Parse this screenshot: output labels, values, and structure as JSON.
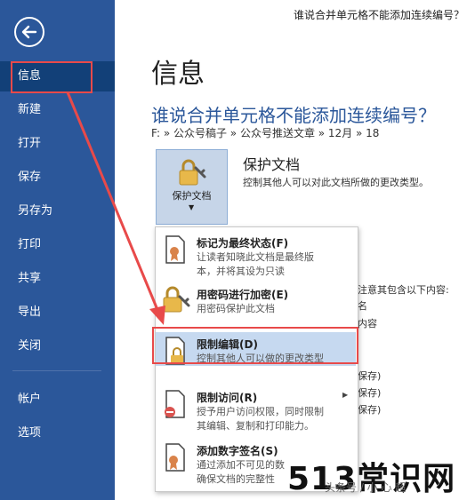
{
  "topbar": {
    "doc_name": "谁说合并单元格不能添加连续编号？"
  },
  "sidebar": {
    "items": [
      {
        "label": "信息"
      },
      {
        "label": "新建"
      },
      {
        "label": "打开"
      },
      {
        "label": "保存"
      },
      {
        "label": "另存为"
      },
      {
        "label": "打印"
      },
      {
        "label": "共享"
      },
      {
        "label": "导出"
      },
      {
        "label": "关闭"
      },
      {
        "label": "帐户"
      },
      {
        "label": "选项"
      }
    ]
  },
  "main": {
    "title": "信息",
    "doc_title": "谁说合并单元格不能添加连续编号？",
    "breadcrumb": "F: » 公众号稿子 » 公众号推送文章 » 12月 » 18",
    "protect": {
      "button_label": "保护文档",
      "heading": "保护文档",
      "description": "控制其他人可以对此文档所做的更改类型。"
    },
    "background_fragments": [
      "注意其包含以下内容:",
      "名",
      "内容",
      "保存)",
      "保存)",
      "保存)"
    ]
  },
  "menu": {
    "items": [
      {
        "title": "标记为最终状态(F)",
        "desc1": "让读者知晓此文档是最终版",
        "desc2": "本，并将其设为只读"
      },
      {
        "title": "用密码进行加密(E)",
        "desc1": "用密码保护此文档",
        "desc2": ""
      },
      {
        "title": "限制编辑(D)",
        "desc1": "控制其他人可以做的更改类型",
        "desc2": ""
      },
      {
        "title": "限制访问(R)",
        "desc1": "授予用户访问权限，同时限制",
        "desc2": "其编辑、复制和打印能力。"
      },
      {
        "title": "添加数字签名(S)",
        "desc1": "通过添加不可见的数",
        "desc2": "确保文档的完整性"
      }
    ]
  },
  "watermark": {
    "text": "513常识网",
    "small": "头条号 / 小  心 超"
  }
}
